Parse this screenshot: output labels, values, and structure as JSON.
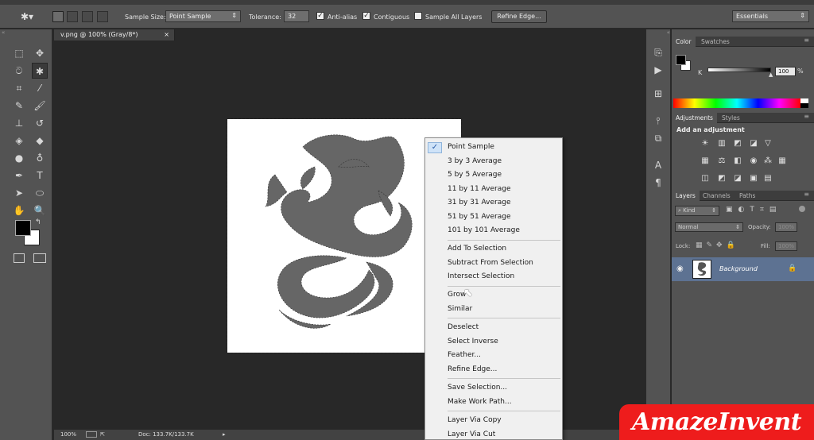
{
  "options_bar": {
    "sample_size_label": "Sample Size:",
    "sample_size_value": "Point Sample",
    "tolerance_label": "Tolerance:",
    "tolerance_value": "32",
    "antialias_label": "Anti-alias",
    "contiguous_label": "Contiguous",
    "sample_all_layers_label": "Sample All Layers",
    "refine_edge_label": "Refine Edge...",
    "workspace_value": "Essentials",
    "antialias_checked": true,
    "contiguous_checked": true,
    "sample_all_layers_checked": false
  },
  "document": {
    "tab_title": "v.png @ 100% (Gray/8*)",
    "zoom": "100%",
    "doc_info": "Doc: 133.7K/133.7K"
  },
  "context_menu": {
    "items": [
      {
        "label": "Point Sample",
        "checked": true
      },
      {
        "label": "3 by 3 Average"
      },
      {
        "label": "5 by 5 Average"
      },
      {
        "label": "11 by 11 Average"
      },
      {
        "label": "31 by 31 Average"
      },
      {
        "label": "51 by 51 Average"
      },
      {
        "label": "101 by 101 Average"
      },
      {
        "label": "Add To Selection"
      },
      {
        "label": "Subtract From Selection"
      },
      {
        "label": "Intersect Selection"
      },
      {
        "label": "Grow"
      },
      {
        "label": "Similar"
      },
      {
        "label": "Deselect"
      },
      {
        "label": "Select Inverse"
      },
      {
        "label": "Feather..."
      },
      {
        "label": "Refine Edge..."
      },
      {
        "label": "Save Selection..."
      },
      {
        "label": "Make Work Path..."
      },
      {
        "label": "Layer Via Copy"
      },
      {
        "label": "Layer Via Cut"
      }
    ]
  },
  "color_panel": {
    "tabs": [
      "Color",
      "Swatches"
    ],
    "channel_label": "K",
    "channel_value": "100"
  },
  "adjustments_panel": {
    "tabs": [
      "Adjustments",
      "Styles"
    ],
    "heading": "Add an adjustment"
  },
  "layers_panel": {
    "tabs": [
      "Layers",
      "Channels",
      "Paths"
    ],
    "filter_value": "Kind",
    "blend_mode": "Normal",
    "opacity_label": "Opacity:",
    "opacity_value": "100%",
    "lock_label": "Lock:",
    "fill_label": "Fill:",
    "fill_value": "100%",
    "layer_name": "Background"
  },
  "watermark": {
    "text": "AmazeInvent"
  }
}
